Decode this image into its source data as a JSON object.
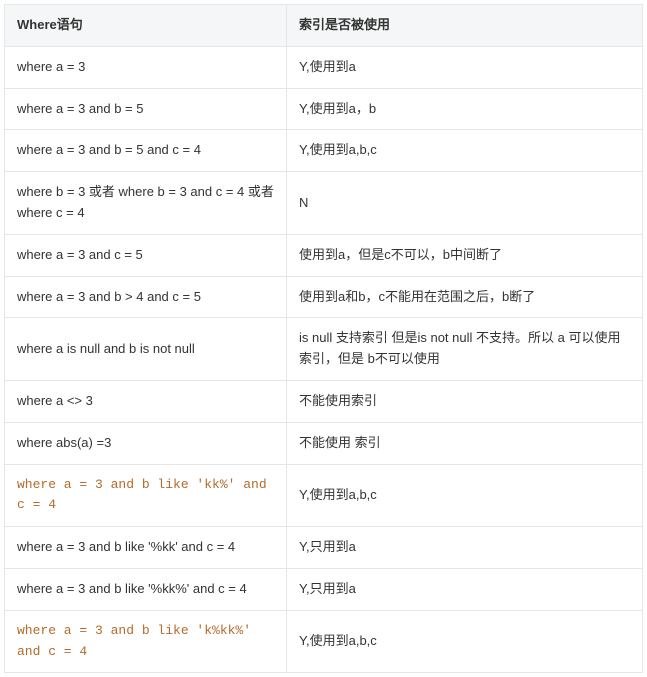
{
  "table": {
    "headers": {
      "where": "Where语句",
      "index": "索引是否被使用"
    },
    "rows": [
      {
        "where": "where a = 3",
        "index": "Y,使用到a",
        "code": false
      },
      {
        "where": "where a = 3 and b = 5",
        "index": "Y,使用到a，b",
        "code": false
      },
      {
        "where": "where a = 3 and b = 5 and c = 4",
        "index": "Y,使用到a,b,c",
        "code": false
      },
      {
        "where": "where b = 3 或者 where b = 3 and c = 4 或者 where c = 4",
        "index": "N",
        "code": false
      },
      {
        "where": "where a = 3 and c = 5",
        "index": "使用到a，但是c不可以，b中间断了",
        "code": false
      },
      {
        "where": "where a = 3 and b > 4 and c = 5",
        "index": "使用到a和b，c不能用在范围之后，b断了",
        "code": false
      },
      {
        "where": "where a is null and b is not null",
        "index": "is null 支持索引 但是is not null 不支持。所以 a 可以使用索引，但是 b不可以使用",
        "code": false
      },
      {
        "where": "where a <> 3",
        "index": "不能使用索引",
        "code": false
      },
      {
        "where": "where abs(a) =3",
        "index": "不能使用 索引",
        "code": false
      },
      {
        "where": "where a = 3 and b like 'kk%' and c = 4",
        "index": "Y,使用到a,b,c",
        "code": true
      },
      {
        "where": "where a = 3 and b like '%kk' and c = 4",
        "index": "Y,只用到a",
        "code": false
      },
      {
        "where": "where a = 3 and b like '%kk%' and c = 4",
        "index": "Y,只用到a",
        "code": false
      },
      {
        "where": "where a = 3 and b like 'k%kk%' and c = 4",
        "index": "Y,使用到a,b,c",
        "code": true
      }
    ]
  }
}
